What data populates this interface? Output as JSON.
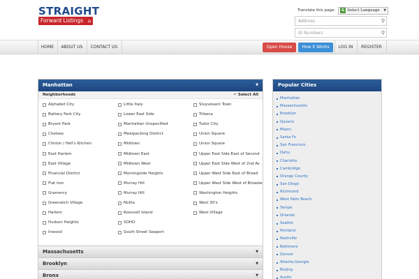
{
  "logo": {
    "line1": "STRAIGHT",
    "line2": "Forward Listings",
    "house_icon": "house-icon"
  },
  "header": {
    "translate_label": "Translate this page:",
    "language_select": "Select Language",
    "address_placeholder": "Address",
    "id_placeholder": "ID Numbers"
  },
  "nav": {
    "home": "HOME",
    "about": "ABOUT US",
    "contact": "CONTACT US",
    "open_house": "Open House",
    "how_it_works": "How it Works",
    "login": "LOG IN",
    "register": "REGISTER"
  },
  "colors": {
    "brand_blue": "#1f4a8a",
    "brand_red": "#c8262b",
    "open_house": "#d84c47",
    "how_it_works": "#3d8fd6"
  },
  "neighborhoods_panel": {
    "title": "Manhattan",
    "subhead": "Neighborhoods",
    "select_all": "Select All",
    "col1": [
      "Alphabet City",
      "Battery Park City",
      "Bryant Park",
      "Chelsea",
      "Clinton / Hell's Kitchen",
      "East Harlem",
      "East Village",
      "Financial District",
      "Flat Iron",
      "Gramercy",
      "Greenwich Village",
      "Harlem",
      "Hudson Heights",
      "Inwood"
    ],
    "col2": [
      "Little Italy",
      "Lower East Side",
      "Manhattan Unspecified",
      "Meatpacking District",
      "Midtown",
      "Midtown East",
      "Midtown West",
      "Morningside Heights",
      "Murray Hill",
      "Murray Hill",
      "Nolita",
      "Roosvelt Island",
      "SOHO",
      "South Street Seaport"
    ],
    "col3": [
      "Stuyvesant Town",
      "Tribeca",
      "Tudor City",
      "Union Square",
      "Union Square",
      "Upper East Side East of Second",
      "Upper East Side West of 2nd Av",
      "Upper West Side East of Broad",
      "Upper West Side West of Broadway",
      "Washington Heights",
      "West 30's",
      "West Village"
    ],
    "collapsed": [
      "Massachusetts",
      "Brooklyn",
      "Bronx"
    ]
  },
  "popular_cities": {
    "title": "Popular Cities",
    "items": [
      "Manhattan",
      "Massachusetts",
      "Brooklyn",
      "Queens",
      "Miami",
      "Santa Fe",
      "San Francisco",
      "Oahu",
      "Charlotte",
      "Cambridge",
      "Orange County",
      "San Diego",
      "Richmond",
      "West Palm Beach",
      "Tampa",
      "Orlando",
      "Seattle",
      "Portland",
      "Nashville",
      "Baltimore",
      "Denver",
      "Atlanta,Georgia",
      "Beijing",
      "Austin"
    ]
  }
}
